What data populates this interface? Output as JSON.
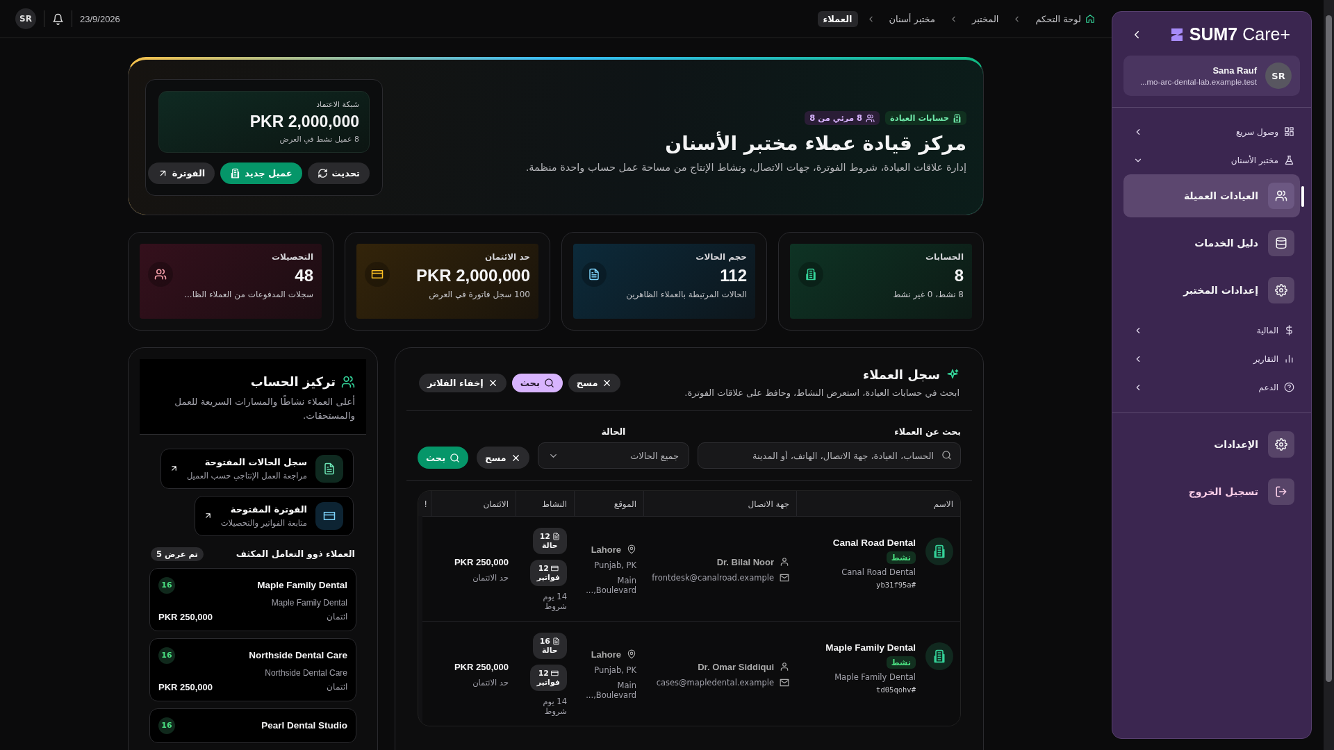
{
  "topbar": {
    "avatar": "SR",
    "date": "23/9/2026",
    "breadcrumbs": [
      {
        "label": "لوحة التحكم",
        "selected": false,
        "kind": "home"
      },
      {
        "label": "المختبر",
        "selected": false
      },
      {
        "label": "مختبر أسنان",
        "selected": false
      },
      {
        "label": "العملاء",
        "selected": true
      }
    ]
  },
  "hero": {
    "badges": [
      {
        "kind": "accounts",
        "label": "حسابات العيادة"
      },
      {
        "kind": "visible",
        "label": "8 مرئي من 8"
      }
    ],
    "title": "مركز قيادة عملاء مختبر الأسنان",
    "subtitle": "إدارة علاقات العيادة، شروط الفوترة، جهات الاتصال، ونشاط الإنتاج من مساحة عمل حساب واحدة منظمة.",
    "credit": {
      "label": "شبكة الاعتماد",
      "value": "PKR 2,000,000",
      "note": "8 عميل نشط في العرض"
    },
    "buttons": [
      {
        "kind": "refresh",
        "label": "تحديث"
      },
      {
        "kind": "new",
        "label": "عميل جديد"
      },
      {
        "kind": "invoice",
        "label": "الفوترة"
      }
    ]
  },
  "stats": [
    {
      "kind": "accounts",
      "label": "الحسابات",
      "value": "8",
      "note": "8 نشط، 0 غير نشط"
    },
    {
      "kind": "cases",
      "label": "حجم الحالات",
      "value": "112",
      "note": "الحالات المرتبطة بالعملاء الظاهرين"
    },
    {
      "kind": "credit",
      "label": "حد الائتمان",
      "value": "PKR 2,000,000",
      "note": "100 سجل فاتورة في العرض"
    },
    {
      "kind": "collections",
      "label": "التحصيلات",
      "value": "48",
      "note": "سجلات المدفوعات من العملاء الظا..."
    }
  ],
  "registry": {
    "title": "سجل العملاء",
    "description": "ابحث في حسابات العيادة، استعرض النشاط، وحافظ على علاقات الفوترة.",
    "chips": [
      {
        "kind": "clear",
        "label": "مسح"
      },
      {
        "kind": "search",
        "label": "بحث"
      },
      {
        "kind": "hide",
        "label": "إخفاء الفلاتر"
      }
    ],
    "search": {
      "label": "بحث عن العملاء",
      "placeholder": "الحساب، العيادة، جهة الاتصال، الهاتف، أو المدينة"
    },
    "status": {
      "label": "الحالة",
      "value": "جميع الحالات"
    },
    "filter_buttons": [
      {
        "kind": "clear",
        "label": "مسح"
      },
      {
        "kind": "search",
        "label": "بحث"
      }
    ],
    "columns": [
      "الاسم",
      "جهة الاتصال",
      "الموقع",
      "النشاط",
      "الائتمان",
      "!"
    ],
    "rows": [
      {
        "name": "Canal Road Dental",
        "status": "نشط",
        "clinic": "Canal Road Dental",
        "code": "#yb31f95a",
        "contact": "Dr. Bilal Noor",
        "email": "frontdesk@canalroad.example",
        "city": "Lahore",
        "region": "Punjab, PK",
        "address": "Main Boulevard,...",
        "activity": [
          {
            "kind": "cases",
            "count": "12",
            "label": "حالة"
          },
          {
            "kind": "invoices",
            "count": "12",
            "label": "فواتير"
          }
        ],
        "terms": "14 يوم شروط",
        "credit": "PKR 250,000",
        "credit_label": "حد الائتمان"
      },
      {
        "name": "Maple Family Dental",
        "status": "نشط",
        "clinic": "Maple Family Dental",
        "code": "#td05qohv",
        "contact": "Dr. Omar Siddiqui",
        "email": "cases@mapledental.example",
        "city": "Lahore",
        "region": "Punjab, PK",
        "address": "Main Boulevard,...",
        "activity": [
          {
            "kind": "cases",
            "count": "16",
            "label": "حالة"
          },
          {
            "kind": "invoices",
            "count": "12",
            "label": "فواتير"
          }
        ],
        "terms": "14 يوم شروط",
        "credit": "PKR 250,000",
        "credit_label": "حد الائتمان"
      }
    ]
  },
  "focus": {
    "title": "تركيز الحساب",
    "description": "أعلى العملاء نشاطًا والمسارات السريعة للعمل والمستحقات.",
    "links": [
      {
        "kind": "cases",
        "title": "سجل الحالات المفتوحة",
        "subtitle": "مراجعة العمل الإنتاجي حسب العميل"
      },
      {
        "kind": "invoice",
        "title": "الفوترة المفتوحة",
        "subtitle": "متابعة الفواتير والتحصيلات"
      }
    ],
    "top_title": "العملاء ذوو التعامل المكثف",
    "top_badge": "تم عرض 5",
    "top_clients": [
      {
        "name": "Maple Family Dental",
        "clinic": "Maple Family Dental",
        "count": "16",
        "credit_label": "ائتمان",
        "credit": "PKR 250,000"
      },
      {
        "name": "Northside Dental Care",
        "clinic": "Northside Dental Care",
        "count": "16",
        "credit_label": "ائتمان",
        "credit": "PKR 250,000"
      },
      {
        "name": "Pearl Dental Studio",
        "count": "16"
      }
    ]
  },
  "sidebar": {
    "logo": "**SUM7** Care+",
    "user": {
      "name": "Sana Rauf",
      "email": "...mo-arc-dental-lab.example.test",
      "initials": "SR"
    },
    "nav": [
      {
        "label": "وصول سريع",
        "kind": "quick",
        "expanded": false
      },
      {
        "label": "مختبر الأسنان",
        "kind": "lab",
        "expanded": true,
        "children": [
          {
            "label": "العيادات العميلة",
            "kind": "clients",
            "selected": true
          },
          {
            "label": "دليل الخدمات",
            "kind": "services",
            "selected": false
          },
          {
            "label": "إعدادات المختبر",
            "kind": "settings",
            "selected": false
          }
        ]
      },
      {
        "label": "المالية",
        "kind": "finance",
        "expanded": false
      },
      {
        "label": "التقارير",
        "kind": "reports",
        "expanded": false
      },
      {
        "label": "الدعم",
        "kind": "support",
        "expanded": false
      }
    ],
    "footer": [
      {
        "kind": "settings",
        "label": "الإعدادات"
      },
      {
        "kind": "logout",
        "label": "تسجيل الخروج"
      }
    ]
  }
}
